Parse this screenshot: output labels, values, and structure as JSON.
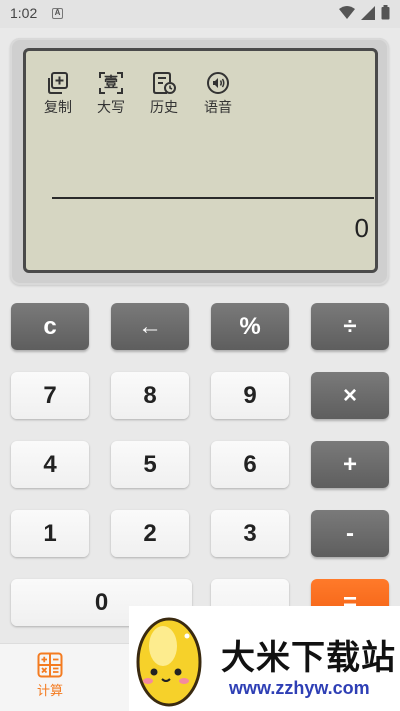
{
  "status_bar": {
    "time": "1:02",
    "notification_icon": "A"
  },
  "toolbar": {
    "copy_label": "复制",
    "uppercase_label": "大写",
    "uppercase_icon_char": "壹",
    "history_label": "历史",
    "voice_label": "语音"
  },
  "display": {
    "expression": "",
    "result": "0"
  },
  "keys": {
    "clear": "c",
    "backspace": "←",
    "percent": "%",
    "divide": "÷",
    "seven": "7",
    "eight": "8",
    "nine": "9",
    "multiply": "×",
    "four": "4",
    "five": "5",
    "six": "6",
    "plus": "+",
    "one": "1",
    "two": "2",
    "three": "3",
    "minus": "-",
    "zero": "0",
    "dot": ".",
    "equals": "="
  },
  "nav": {
    "calc_label": "计算"
  },
  "watermark": {
    "title": "大米下载站",
    "url": "www.zzhyw.com"
  },
  "colors": {
    "accent": "#f47b20",
    "equals_key": "#f46a1c",
    "dark_key": "#6b6b6b",
    "light_key": "#f6f6f6",
    "screen": "#d6d6c2"
  }
}
